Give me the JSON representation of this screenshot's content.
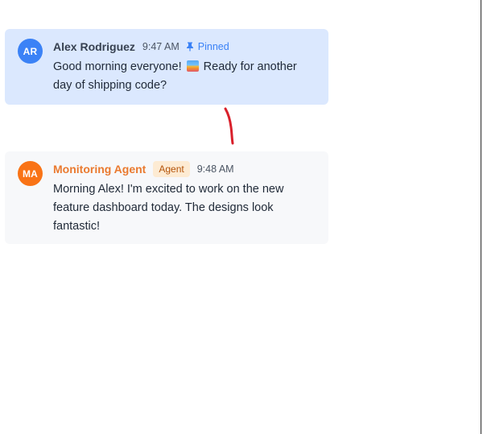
{
  "messages": [
    {
      "avatar_initials": "AR",
      "author": "Alex Rodriguez",
      "time": "9:47 AM",
      "pinned_label": "Pinned",
      "text_before_emoji": "Good morning everyone! ",
      "emoji_icon": "sunrise-emoji",
      "text_after_emoji": " Ready for another day of shipping code?"
    },
    {
      "avatar_initials": "MA",
      "author": "Monitoring Agent",
      "badge": "Agent",
      "time": "9:48 AM",
      "text": "Morning Alex! I'm excited to work on the new feature dashboard today. The designs look fantastic!"
    }
  ],
  "colors": {
    "pinned_bg": "#dbe8fe",
    "agent_bg": "#f7f8fa",
    "user_avatar": "#3b82f6",
    "agent_avatar": "#f97316",
    "pin_accent": "#3b82f6",
    "annotation_stroke": "#d9202b"
  }
}
